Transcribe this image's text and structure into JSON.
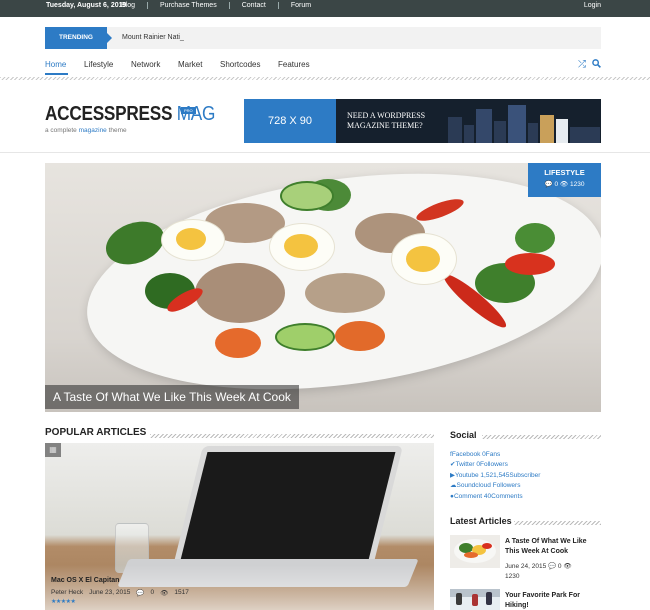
{
  "topbar": {
    "date": "Tuesday, August 6, 2019",
    "links": [
      "Blog",
      "Purchase Themes",
      "Contact",
      "Forum"
    ],
    "login": "Login"
  },
  "trending": {
    "label": "TRENDING",
    "text": "Mount Rainier Nati_"
  },
  "nav": {
    "items": [
      "Home",
      "Lifestyle",
      "Network",
      "Market",
      "Shortcodes",
      "Features"
    ],
    "active": "Home",
    "icons": [
      "shuffle-icon",
      "search-icon"
    ]
  },
  "logo": {
    "title_main": "ACCESSPRESS",
    "title_accent": "MAG",
    "badge": "PRO",
    "tagline_prefix": "a complete",
    "tagline_accent": "magazine",
    "tagline_suffix": "theme"
  },
  "ad": {
    "size": "728 X 90",
    "line1": "NEED A WORDPRESS",
    "line2": "MAGAZINE THEME?"
  },
  "hero": {
    "category": "LIFESTYLE",
    "comments": "0",
    "views": "1230",
    "caption": "A Taste Of What We Like This Week At Cook"
  },
  "popular": {
    "heading": "POPULAR ARTICLES",
    "article": {
      "title": "Mac OS X El Capitan",
      "author": "Peter Heck",
      "date": "June 23, 2015",
      "comments": "0",
      "views": "1517",
      "rating": 4.5
    }
  },
  "sidebar": {
    "social_heading": "Social",
    "social": [
      {
        "icon": "facebook-icon",
        "glyph": "f",
        "text": "Facebook 0Fans"
      },
      {
        "icon": "twitter-icon",
        "glyph": "✔",
        "text": "Twitter 0Followers"
      },
      {
        "icon": "youtube-icon",
        "glyph": "▶",
        "text": "Youtube 1,521,545Subscriber"
      },
      {
        "icon": "soundcloud-icon",
        "glyph": "☁",
        "text": "Soundcloud Followers"
      },
      {
        "icon": "comment-icon",
        "glyph": "●",
        "text": "Comment 40Comments"
      }
    ],
    "latest_heading": "Latest Articles",
    "latest": [
      {
        "title": "A Taste Of What We Like This Week At Cook",
        "date": "June 24, 2015",
        "comments": "0",
        "views": "1230"
      },
      {
        "title": "Your Favorite Park For Hiking!",
        "date": "",
        "comments": "",
        "views": ""
      }
    ]
  },
  "colors": {
    "accent": "#2d7bc5",
    "topbar": "#3b4646"
  }
}
